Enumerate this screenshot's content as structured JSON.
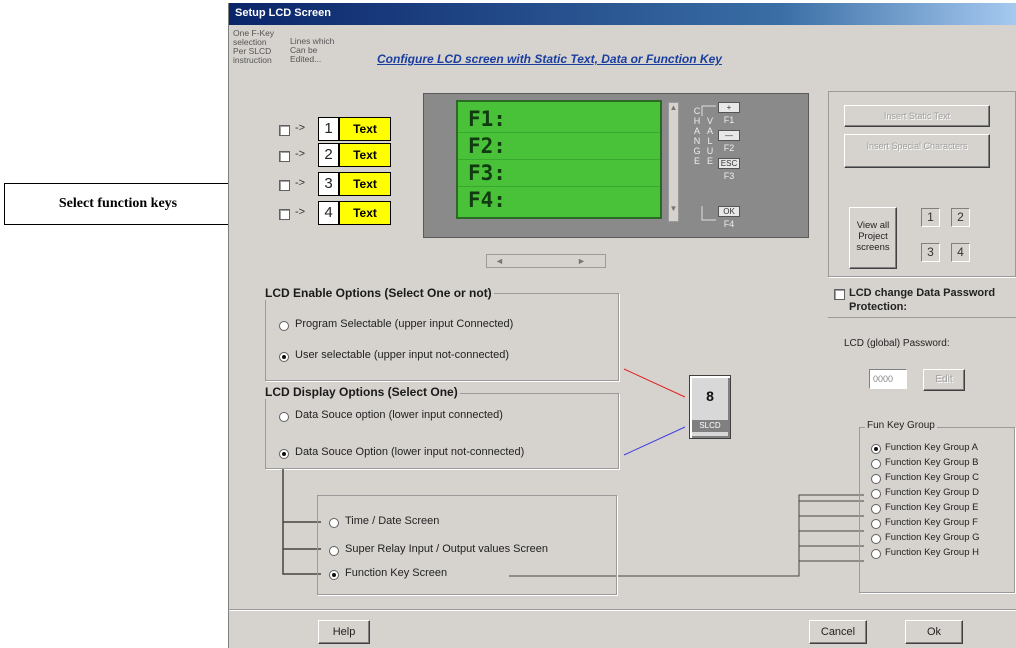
{
  "window": {
    "title": "Setup LCD Screen"
  },
  "left_help": {
    "col1": [
      "One F-Key",
      "selection",
      "Per SLCD",
      "instruction"
    ],
    "col2": [
      "Lines which",
      "Can be",
      "Edited..."
    ]
  },
  "headline": "Configure LCD screen with Static Text, Data or Function Key",
  "rows": [
    {
      "num": "1",
      "text": "Text",
      "arrow": "->"
    },
    {
      "num": "2",
      "text": "Text",
      "arrow": "->"
    },
    {
      "num": "3",
      "text": "Text",
      "arrow": "->"
    },
    {
      "num": "4",
      "text": "Text",
      "arrow": "->"
    }
  ],
  "lcd_lines": [
    "F1:",
    "F2:",
    "F3:",
    "F4:"
  ],
  "change_value": {
    "change": [
      "C",
      "H",
      "A",
      "N",
      "G",
      "E"
    ],
    "value": [
      "V",
      "A",
      "L",
      "U",
      "E"
    ]
  },
  "keys": [
    {
      "symbol": "+",
      "label": "F1"
    },
    {
      "symbol": "—",
      "label": "F2"
    },
    {
      "symbol": "ESC",
      "label": "F3"
    },
    {
      "symbol": "OK",
      "label": "F4"
    }
  ],
  "right_buttons": {
    "insert_static": "Insert Static Text",
    "insert_special": "Insert Special Characters",
    "view_all": "View all Project screens",
    "screens": [
      "1",
      "2",
      "3",
      "4"
    ]
  },
  "password": {
    "checkbox_label": "LCD change Data Password Protection:",
    "global_label": "LCD (global) Password:",
    "value": "0000",
    "edit": "Edit"
  },
  "enable_options": {
    "title": "LCD Enable Options (Select One or not)",
    "options": [
      "Program Selectable (upper input Connected)",
      "User selectable (upper input not-connected)"
    ],
    "selected": 1
  },
  "display_options": {
    "title": "LCD Display Options (Select One)",
    "options": [
      "Data Souce option (lower input connected)",
      "Data Souce Option (lower input not-connected)"
    ],
    "selected": 1
  },
  "slcd_block": {
    "number": "8",
    "label": "SLCD"
  },
  "screen_options": {
    "options": [
      "Time / Date Screen",
      "Super Relay Input / Output values Screen",
      "Function Key Screen"
    ],
    "selected": 2
  },
  "fun_key_group": {
    "title": "Fun Key Group",
    "items": [
      "Function Key Group A",
      "Function Key Group B",
      "Function Key Group C",
      "Function Key Group D",
      "Function Key Group E",
      "Function Key Group F",
      "Function Key Group G",
      "Function Key Group H"
    ],
    "selected": 0
  },
  "bottom_buttons": {
    "help": "Help",
    "cancel": "Cancel",
    "ok": "Ok"
  },
  "callout": "Select function keys",
  "colors": {
    "lcd_green": "#49c23a",
    "text_yellow": "#ffff00",
    "headline_blue": "#1a3ea0",
    "title_bar": "#0a246a"
  }
}
